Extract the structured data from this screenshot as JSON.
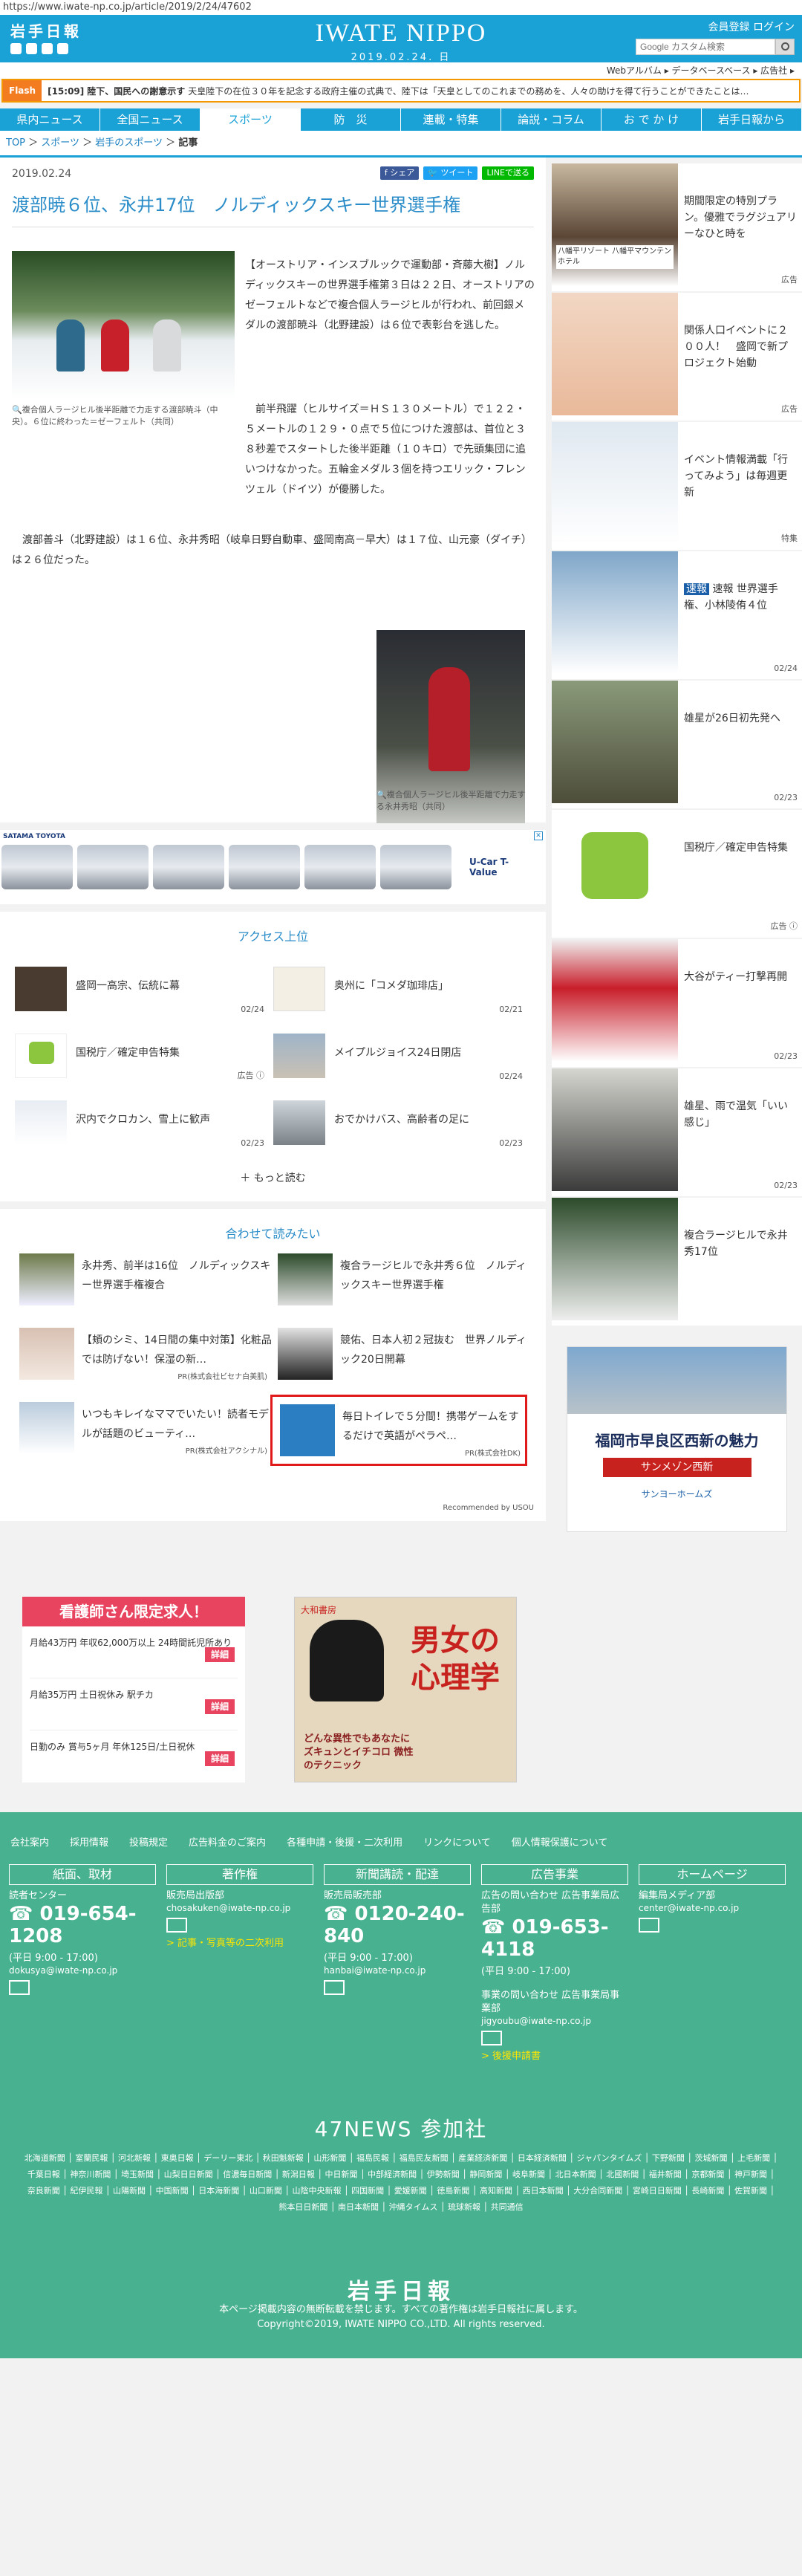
{
  "url": "https://www.iwate-np.co.jp/article/2019/2/24/47602",
  "header": {
    "logo": "岩手日報",
    "brand": "IWATE NIPPO",
    "date": "2019.02.24.  日",
    "toplinks": "会員登録  ログイン",
    "search_placeholder": "Google カスタム検索",
    "sublinks": "Webアルバム ▸  データベースベース ▸  広告社 ▸"
  },
  "flash": {
    "tag": "Flash",
    "time": "[15:09]",
    "headline": "陸下、国民への謝意示す",
    "text": "天皇陸下の在位３０年を記念する政府主催の式典で、陸下は「天皇としてのこれまでの務めを、人々の助けを得て行うことができたことは…"
  },
  "nav": [
    "県内ニュース",
    "全国ニュース",
    "スポーツ",
    "防　災",
    "連載・特集",
    "論説・コラム",
    "お で か け",
    "岩手日報から"
  ],
  "breadcrumb": {
    "top": "TOP",
    "sports": "スポーツ",
    "local": "岩手のスポーツ",
    "current": "記事"
  },
  "article": {
    "date": "2019.02.24",
    "title": "渡部暁６位、永井17位　ノルディックスキー世界選手権",
    "shares": [
      "f シェア",
      "🐦 ツイート",
      "LINEで送る"
    ],
    "caption1": "複合個人ラージヒル後半距離で力走する渡部暁斗（中央）。６位に終わった＝ゼーフェルト（共同）",
    "para1": "【オーストリア・インスブルックで運動部・斉藤大樹】ノルディックスキーの世界選手権第３日は２２日、オーストリアのゼーフェルトなどで複合個人ラージヒルが行われ、前回銀メダルの渡部暁斗（北野建設）は６位で表彰台を逃した。",
    "para2": "前半飛躍（ヒルサイズ＝ＨＳ１３０メートル）で１２２・５メートルの１２９・０点で５位につけた渡部は、首位と３８秒差でスタートした後半距離（１０キロ）で先頭集団に追いつけなかった。五輪金メダル３個を持つエリック・フレンツェル（ドイツ）が優勝した。",
    "para3": "渡部善斗（北野建設）は１６位、永井秀昭（岐阜日野自動車、盛岡南高－早大）は１７位、山元豪（ダイチ）は２６位だった。",
    "caption2": "複合個人ラージヒル後半距離で力走する永井秀昭（共同）"
  },
  "ad_cars": {
    "label": "SATAMA TOYOTA",
    "brand": "U-Car T-Value"
  },
  "access": {
    "title": "アクセス上位",
    "items": [
      {
        "text": "盛岡一高宗、伝統に幕",
        "date": "02/24"
      },
      {
        "text": "奥州に「コメダ珈琲店」",
        "date": "02/21"
      },
      {
        "text": "国税庁／確定申告特集",
        "date": "広告 ⓘ"
      },
      {
        "text": "メイプルジョイス24日閉店",
        "date": "02/24"
      },
      {
        "text": "沢内でクロカン、雪上に歓声",
        "date": "02/23"
      },
      {
        "text": "おでかけバス、高齢者の足に",
        "date": "02/23"
      }
    ],
    "more": "もっと読む"
  },
  "related": {
    "title": "合わせて読みたい",
    "items": [
      {
        "text": "永井秀、前半は16位　ノルディックスキー世界選手権複合",
        "pr": ""
      },
      {
        "text": "複合ラージヒルで永井秀６位　ノルディックスキー世界選手権",
        "pr": ""
      },
      {
        "text": "【頬のシミ、14日間の集中対策】化粧品では防げない！保湿の新…",
        "pr": "PR(株式会社ビセナ白美肌)"
      },
      {
        "text": "競佑、日本人初２冠抜む　世界ノルディック20日開幕",
        "pr": ""
      },
      {
        "text": "いつもキレイなママでいたい！読者モデルが話題のビューティ…",
        "pr": "PR(株式会社アクシナル)"
      },
      {
        "text": "毎日トイレで５分間！携帯ゲームをするだけで英語がペラペ…",
        "pr": "PR(株式会社DK)"
      }
    ],
    "recommended": "Recommended by  USOU"
  },
  "ad_nurse": {
    "title": "看護師さん限定求人！",
    "rows": [
      "月給43万円 年収62,000万以上 24時間託児所あり",
      "月給35万円 土日祝休み 駅チカ",
      "日勤のみ 賞与5ヶ月 年休125日/土日祝休"
    ],
    "button": "詳細"
  },
  "ad_book": {
    "pub": "大和書房",
    "title": "男女の心理学",
    "sub": "どんな異性でもあなたにズキュンとイチコロ 微性のテクニック"
  },
  "side": [
    {
      "text": "期間限定の特別プラン。優雅でラグジュアリーなひと時を",
      "date": "広告",
      "brand": "八幡平リゾート 八幡平マウンテンホテル"
    },
    {
      "text": "関係人口イベントに２００人！　盛岡で新プロジェクト始動",
      "date": "広告"
    },
    {
      "text": "イベント情報満載「行ってみよう」は毎週更新",
      "date": "特集"
    },
    {
      "text": "速報 世界選手権、小林陵侑４位",
      "date": "02/24"
    },
    {
      "text": "雄星が26日初先発へ",
      "date": "02/23"
    },
    {
      "text": "国税庁／確定申告特集",
      "date": "広告 ⓘ"
    },
    {
      "text": "大谷がティー打撃再開",
      "date": "02/23"
    },
    {
      "text": "雄星、雨で温気「いい感じ」",
      "date": "02/23"
    },
    {
      "text": "複合ラージヒルで永井秀17位",
      "date": ""
    }
  ],
  "ad_fukuoka": {
    "title": "福岡市早良区西新の魅力",
    "sub": "サンメゾン西新",
    "brand": "サンヨーホームズ"
  },
  "footer": {
    "links": [
      "会社案内",
      "採用情報",
      "投稿規定",
      "広告料金のご案内",
      "各種申請・後援・二次利用",
      "リンクについて",
      "個人情報保護について"
    ],
    "cols": [
      {
        "h": "紙面、取材",
        "s": "読者センター",
        "tel": "019-654-1208",
        "hours": "(平日 9:00 - 17:00)",
        "mail": "dokusya@iwate-np.co.jp"
      },
      {
        "h": "著作権",
        "s": "販売局出版部",
        "tel": "",
        "hours": "",
        "mail": "chosakuken@iwate-np.co.jp",
        "link": "> 記事・写真等の二次利用"
      },
      {
        "h": "新聞講読・配達",
        "s": "販売局販売部",
        "tel": "0120-240-840",
        "hours": "(平日 9:00 - 17:00)",
        "mail": "hanbai@iwate-np.co.jp"
      },
      {
        "h": "広告事業",
        "s": "広告の問い合わせ 広告事業局広告部",
        "tel": "019-653-4118",
        "hours": "(平日 9:00 - 17:00)",
        "mail": "jigyoubu@iwate-np.co.jp",
        "s2": "事業の問い合わせ 広告事業局事業部",
        "link": "> 後援申請書"
      },
      {
        "h": "ホームページ",
        "s": "編集局メディア部",
        "tel": "",
        "hours": "",
        "mail": "center@iwate-np.co.jp"
      }
    ],
    "n47_title": "47NEWS 参加社",
    "n47_list": "北海道新聞 │ 室蘭民報 │ 河北新報 │ 東奥日報 │ デーリー東北 │ 秋田魁新報 │ 山形新聞 │ 福島民報 │ 福島民友新聞 │ 産業経済新聞 │ 日本経済新聞 │ ジャパンタイムズ │ 下野新聞 │ 茨城新聞 │ 上毛新聞 │ 千葉日報 │ 神奈川新聞 │ 埼玉新聞 │ 山梨日日新聞 │ 信濃毎日新聞 │ 新潟日報 │ 中日新聞 │ 中部経済新聞 │ 伊勢新聞 │ 静岡新聞 │ 岐阜新聞 │ 北日本新聞 │ 北國新聞 │ 福井新聞 │ 京都新聞 │ 神戸新聞 │ 奈良新聞 │ 紀伊民報 │ 山陽新聞 │ 中国新聞 │ 日本海新聞 │ 山口新聞 │ 山陰中央新報 │ 四国新聞 │ 愛媛新聞 │ 徳島新聞 │ 高知新聞 │ 西日本新聞 │ 大分合同新聞 │ 宮崎日日新聞 │ 長崎新聞 │ 佐賀新聞 │ 熊本日日新聞 │ 南日本新聞 │ 沖縄タイムス │ 琉球新報 │ 共同通信",
    "logo": "岩手日報",
    "notice": "本ページ掲載内容の無断転載を禁じます。すべての著作権は岩手日報社に属します。",
    "copyright": "Copyright©2019, IWATE NIPPO CO.,LTD. All rights reserved."
  }
}
